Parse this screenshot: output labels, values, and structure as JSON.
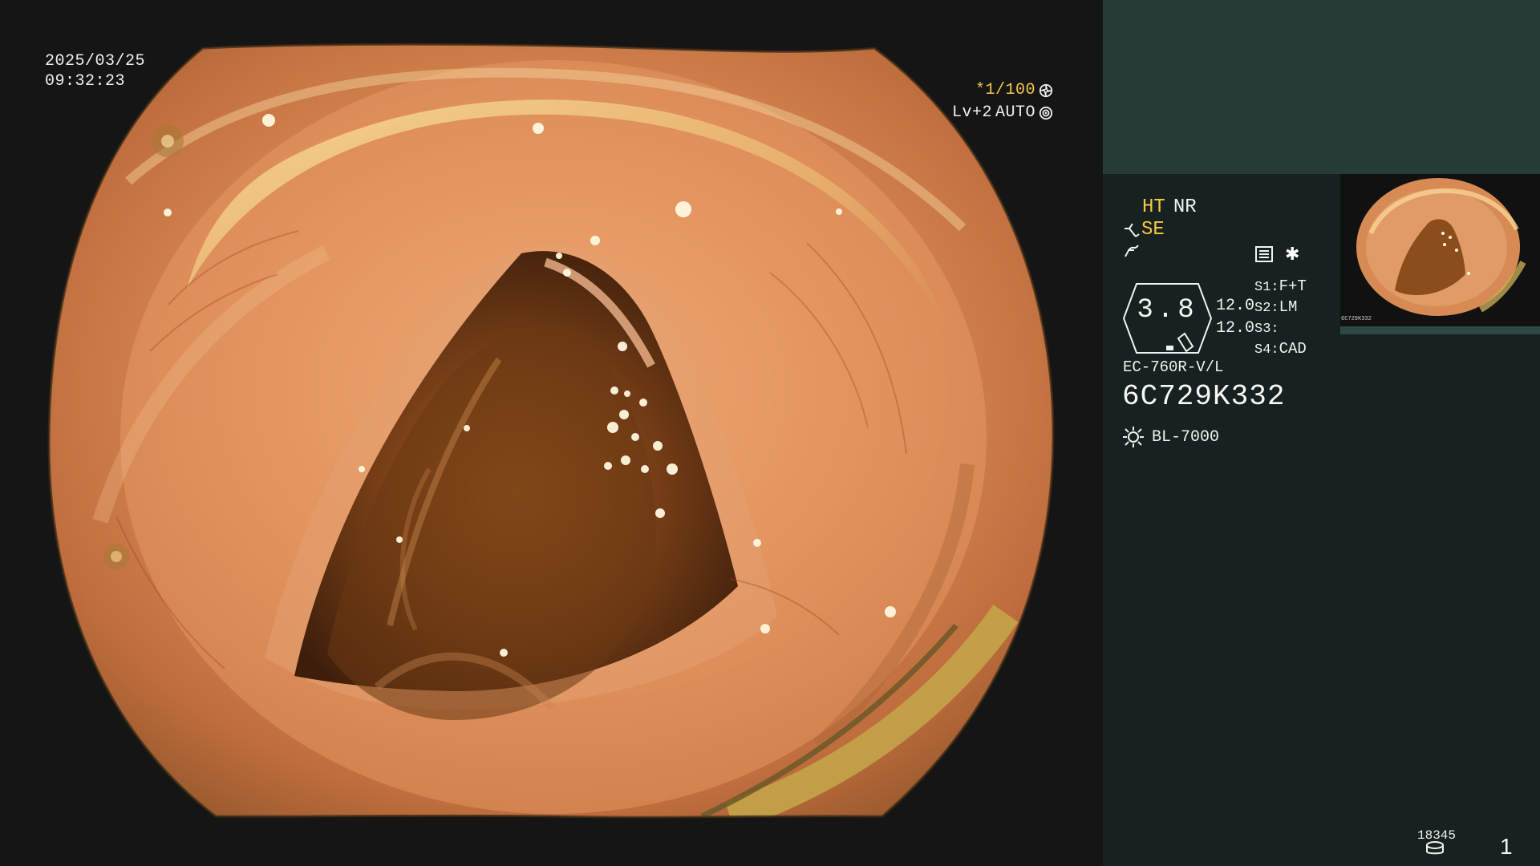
{
  "capture": {
    "date": "2025/03/25",
    "time": "09:32:23"
  },
  "exposure": {
    "shutter": "*1/100",
    "level": "Lv+2",
    "mode": "AUTO"
  },
  "enhancement": {
    "ht": "HT",
    "nr": "NR",
    "se": "SE"
  },
  "gauge": {
    "value": "3.8"
  },
  "readouts": [
    "12.0",
    "12.0"
  ],
  "presets": [
    {
      "label": "S1:",
      "value": "F+T"
    },
    {
      "label": "S2:",
      "value": "LM"
    },
    {
      "label": "S3:",
      "value": ""
    },
    {
      "label": "S4:",
      "value": "CAD"
    }
  ],
  "device": {
    "scope_model": "EC-760R-V/L",
    "serial": "6C729K332",
    "light_source": "BL-7000"
  },
  "footer": {
    "counter": "18345",
    "page": "1"
  },
  "thumbnail": {
    "label": "6C729K332"
  },
  "icons": {
    "shutter": "aperture-icon",
    "auto": "target-icon",
    "fold": "fold-icon",
    "wave": "wave-icon",
    "menu": "menu-icon",
    "star": "star-icon",
    "light": "light-icon",
    "storage": "storage-icon"
  },
  "colors": {
    "accent": "#f5c84a",
    "panel": "#17211f",
    "panel_top": "#263c38",
    "text": "#f2f2f2"
  }
}
